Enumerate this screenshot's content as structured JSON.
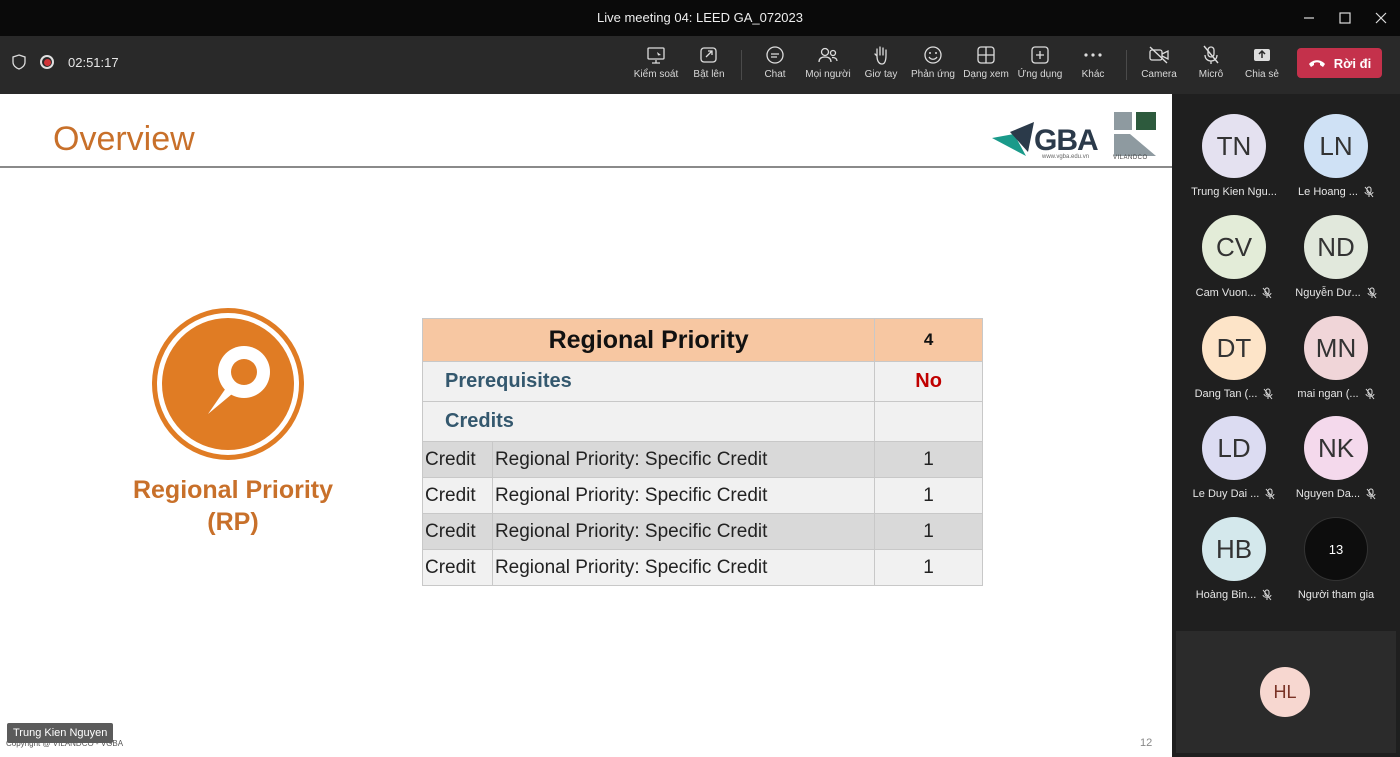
{
  "window": {
    "title": "Live meeting 04: LEED GA_072023"
  },
  "toolbar": {
    "timer": "02:51:17",
    "buttons": [
      {
        "label": "Kiểm soát",
        "icon": "share-control-icon"
      },
      {
        "label": "Bật lên",
        "icon": "popout-icon"
      },
      {
        "label": "Chat",
        "icon": "chat-icon"
      },
      {
        "label": "Mọi người",
        "icon": "people-icon"
      },
      {
        "label": "Giơ tay",
        "icon": "raise-hand-icon"
      },
      {
        "label": "Phản ứng",
        "icon": "reaction-icon"
      },
      {
        "label": "Dạng xem",
        "icon": "view-icon"
      },
      {
        "label": "Ứng dụng",
        "icon": "apps-icon"
      },
      {
        "label": "Khác",
        "icon": "more-icon"
      },
      {
        "label": "Camera",
        "icon": "camera-off-icon"
      },
      {
        "label": "Micrô",
        "icon": "mic-off-icon"
      },
      {
        "label": "Chia sẻ",
        "icon": "share-icon"
      }
    ],
    "leave_label": "Rời đi"
  },
  "slide": {
    "title": "Overview",
    "logo_gba": "GBA",
    "logo_gba_url": "www.vgba.edu.vn",
    "logo_vilandco": "VILANDCO",
    "rp_label_line1": "Regional Priority",
    "rp_label_line2": "(RP)",
    "table": {
      "header": {
        "name": "Regional Priority",
        "value": "4"
      },
      "prerequisites": {
        "label": "Prerequisites",
        "value": "No"
      },
      "credits": {
        "label": "Credits",
        "value": ""
      },
      "rows": [
        {
          "type": "Credit",
          "name": "Regional Priority: Specific Credit",
          "value": "1"
        },
        {
          "type": "Credit",
          "name": "Regional Priority: Specific Credit",
          "value": "1"
        },
        {
          "type": "Credit",
          "name": "Regional Priority: Specific Credit",
          "value": "1"
        },
        {
          "type": "Credit",
          "name": "Regional Priority: Specific Credit",
          "value": "1"
        }
      ]
    },
    "copyright": "Copyright @ VILANDCO - VGBA",
    "page_number": "12"
  },
  "speaker_tag": "Trung Kien Nguyen",
  "participants": [
    {
      "initials": "TN",
      "name": "Trung Kien Ngu...",
      "muted": false,
      "color": "#e4e1f0"
    },
    {
      "initials": "LN",
      "name": "Le Hoang ...",
      "muted": true,
      "color": "#cfe1f5"
    },
    {
      "initials": "CV",
      "name": "Cam Vuon...",
      "muted": true,
      "color": "#e3ecd8"
    },
    {
      "initials": "ND",
      "name": "Nguyễn Dư...",
      "muted": true,
      "color": "#e1e8dc"
    },
    {
      "initials": "DT",
      "name": "Dang Tan (...",
      "muted": true,
      "color": "#fde4c8"
    },
    {
      "initials": "MN",
      "name": "mai ngan (...",
      "muted": true,
      "color": "#f0d5d8"
    },
    {
      "initials": "LD",
      "name": "Le Duy Dai ...",
      "muted": true,
      "color": "#dcdcf2"
    },
    {
      "initials": "NK",
      "name": "Nguyen Da...",
      "muted": true,
      "color": "#f4d9ec"
    },
    {
      "initials": "HB",
      "name": "Hoàng Bin...",
      "muted": true,
      "color": "#d4e8ec"
    },
    {
      "initials": "13",
      "name": "Người tham gia",
      "muted": false,
      "color": "#0d0d0d"
    }
  ],
  "self": {
    "initials": "HL"
  }
}
